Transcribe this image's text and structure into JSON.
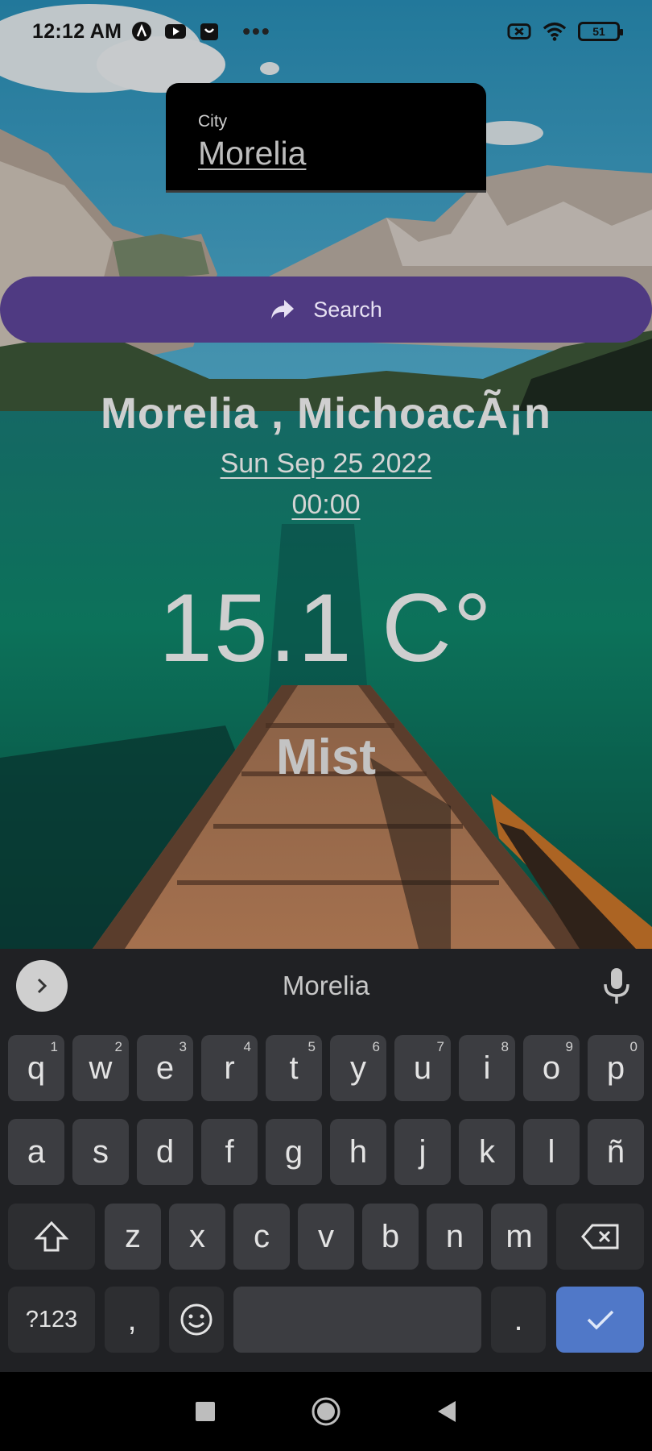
{
  "status_bar": {
    "time": "12:12 AM",
    "more": "•••",
    "battery": "51"
  },
  "city_field": {
    "label": "City",
    "value": "Morelia"
  },
  "search_button": {
    "label": "Search",
    "icon": "share-arrow-icon",
    "color": "#4f3a82"
  },
  "weather": {
    "location": "Morelia , MichoacÃ¡n",
    "date": "Sun Sep 25 2022",
    "time": "00:00",
    "temperature": "15.1 C°",
    "condition": "Mist"
  },
  "keyboard": {
    "suggestion": "Morelia",
    "row1": [
      {
        "k": "q",
        "h": "1"
      },
      {
        "k": "w",
        "h": "2"
      },
      {
        "k": "e",
        "h": "3"
      },
      {
        "k": "r",
        "h": "4"
      },
      {
        "k": "t",
        "h": "5"
      },
      {
        "k": "y",
        "h": "6"
      },
      {
        "k": "u",
        "h": "7"
      },
      {
        "k": "i",
        "h": "8"
      },
      {
        "k": "o",
        "h": "9"
      },
      {
        "k": "p",
        "h": "0"
      }
    ],
    "row2": [
      "a",
      "s",
      "d",
      "f",
      "g",
      "h",
      "j",
      "k",
      "l",
      "ñ"
    ],
    "row3": [
      "z",
      "x",
      "c",
      "v",
      "b",
      "n",
      "m"
    ],
    "symbols_key": "?123",
    "comma_key": ",",
    "period_key": ".",
    "enter_color": "#5078c8"
  }
}
